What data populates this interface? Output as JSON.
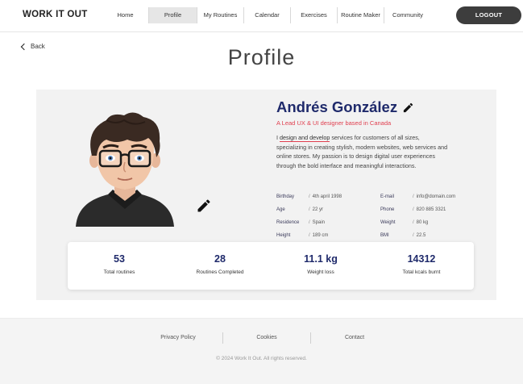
{
  "header": {
    "brand": "WORK IT OUT",
    "nav": [
      "Home",
      "Profile",
      "My Routines",
      "Calendar",
      "Exercises",
      "Routine Maker",
      "Community"
    ],
    "active_nav": "Profile",
    "logout_label": "LOGOUT"
  },
  "back_label": "Back",
  "page_title": "Profile",
  "profile": {
    "name": "Andrés González",
    "subtitle": "A Lead UX & UI designer based in Canada",
    "bio_prefix": "I ",
    "bio_highlight": "design and develop",
    "bio_rest": " services for customers of all sizes, specializing in creating stylish, modern websites, web services and online stores. My passion is to design digital user experiences through the bold interface and meaningful interactions.",
    "details": [
      {
        "label": "Birthday",
        "value": "4th april 1998"
      },
      {
        "label": "E-mail",
        "value": "info@domain.com"
      },
      {
        "label": "Age",
        "value": "22 yr"
      },
      {
        "label": "Phone",
        "value": "820 885 3321"
      },
      {
        "label": "Residence",
        "value": "Spain"
      },
      {
        "label": "Weight",
        "value": "80 kg"
      },
      {
        "label": "Height",
        "value": "189 cm"
      },
      {
        "label": "BMI",
        "value": "22.5"
      }
    ]
  },
  "stats": [
    {
      "value": "53",
      "label": "Total routines"
    },
    {
      "value": "28",
      "label": "Routines Completed"
    },
    {
      "value": "11.1 kg",
      "label": "Weight loss"
    },
    {
      "value": "14312",
      "label": "Total kcals burnt"
    }
  ],
  "footer": {
    "links": [
      "Privacy Policy",
      "Cookies",
      "Contact"
    ],
    "copyright": "© 2024 Work It Out.  All rights reserved."
  },
  "colors": {
    "accent_dark": "#1f2a6b",
    "highlight": "#e04050",
    "logout_bg": "#3d3d3d"
  }
}
